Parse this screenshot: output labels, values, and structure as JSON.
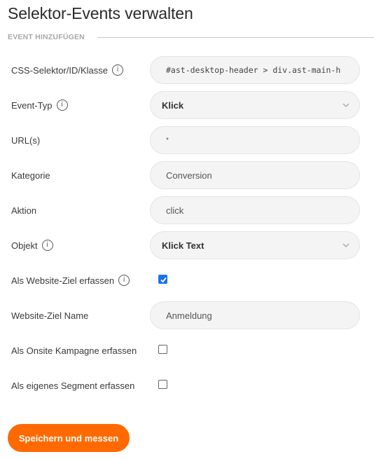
{
  "page": {
    "title": "Selektor-Events verwalten",
    "section_title": "EVENT HINZUFÜGEN"
  },
  "form": {
    "css_selector": {
      "label": "CSS-Selektor/ID/Klasse",
      "value": "#ast-desktop-header > div.ast-main-h",
      "info_icon": "info-icon"
    },
    "event_type": {
      "label": "Event-Typ",
      "value": "Klick",
      "info_icon": "info-icon",
      "icon": "chevron-down-icon"
    },
    "urls": {
      "label": "URL(s)",
      "value": "*"
    },
    "category": {
      "label": "Kategorie",
      "value": "Conversion"
    },
    "action": {
      "label": "Aktion",
      "value": "click"
    },
    "object": {
      "label": "Objekt",
      "value": "Klick Text",
      "info_icon": "info-icon",
      "icon": "chevron-down-icon"
    },
    "website_goal": {
      "label": "Als Website-Ziel erfassen",
      "checked": true,
      "info_icon": "info-icon"
    },
    "website_goal_name": {
      "label": "Website-Ziel Name",
      "value": "Anmeldung"
    },
    "onsite_campaign": {
      "label": "Als Onsite Kampagne erfassen",
      "checked": false
    },
    "own_segment": {
      "label": "Als eigenes Segment erfassen",
      "checked": false
    }
  },
  "actions": {
    "save_label": "Speichern und messen"
  },
  "colors": {
    "accent": "#ff6a00",
    "checkbox_checked": "#1a73e8",
    "field_background": "#f4f4f4"
  }
}
